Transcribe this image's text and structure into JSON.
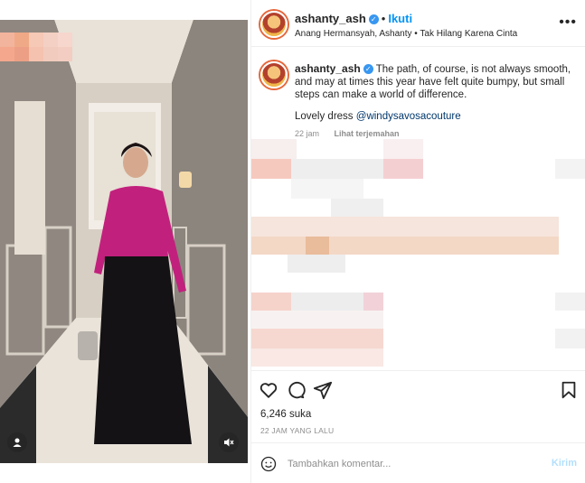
{
  "post": {
    "username": "ashanty_ash",
    "verified_icon": "verified-badge-icon",
    "follow_label": "Ikuti",
    "music_line": "Anang Hermansyah, Ashanty • Tak Hilang Karena Cinta",
    "more_icon": "more-options-icon"
  },
  "caption": {
    "username": "ashanty_ash",
    "text": "The path, of course, is not always smooth, and may at times this year have felt quite bumpy, but small steps can make a world of difference.",
    "dress_prefix": "Lovely dress ",
    "mention": "@windysavosacouture",
    "age": "22 jam",
    "translate": "Lihat terjemahan"
  },
  "engagement": {
    "likes": "6,246 suka",
    "timestamp": "22 JAM YANG LALU"
  },
  "comment_form": {
    "placeholder": "Tambahkan komentar...",
    "send_label": "Kirim"
  },
  "colors": {
    "accent": "#0095f6",
    "mention": "#00376b",
    "muted": "#8e8e8e",
    "send_disabled": "#b2dffc"
  }
}
